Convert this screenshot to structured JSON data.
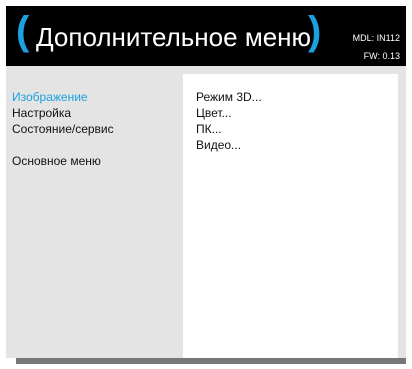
{
  "header": {
    "title": "Дополнительное меню",
    "paren_left": "(",
    "paren_right": ")",
    "model": "MDL: IN112",
    "firmware": "FW: 0.13"
  },
  "nav": {
    "items": [
      {
        "label": "Изображение",
        "active": true
      },
      {
        "label": "Настройка",
        "active": false
      },
      {
        "label": "Состояние/сервис",
        "active": false
      }
    ],
    "main_menu": "Основное меню"
  },
  "submenu": {
    "items": [
      {
        "label": "Режим 3D..."
      },
      {
        "label": "Цвет..."
      },
      {
        "label": "ПК..."
      },
      {
        "label": "Видео..."
      }
    ]
  },
  "colors": {
    "accent": "#1ba1e2",
    "header_bg": "#000000",
    "panel_bg": "#e4e4e4",
    "submenu_bg": "#ffffff"
  }
}
